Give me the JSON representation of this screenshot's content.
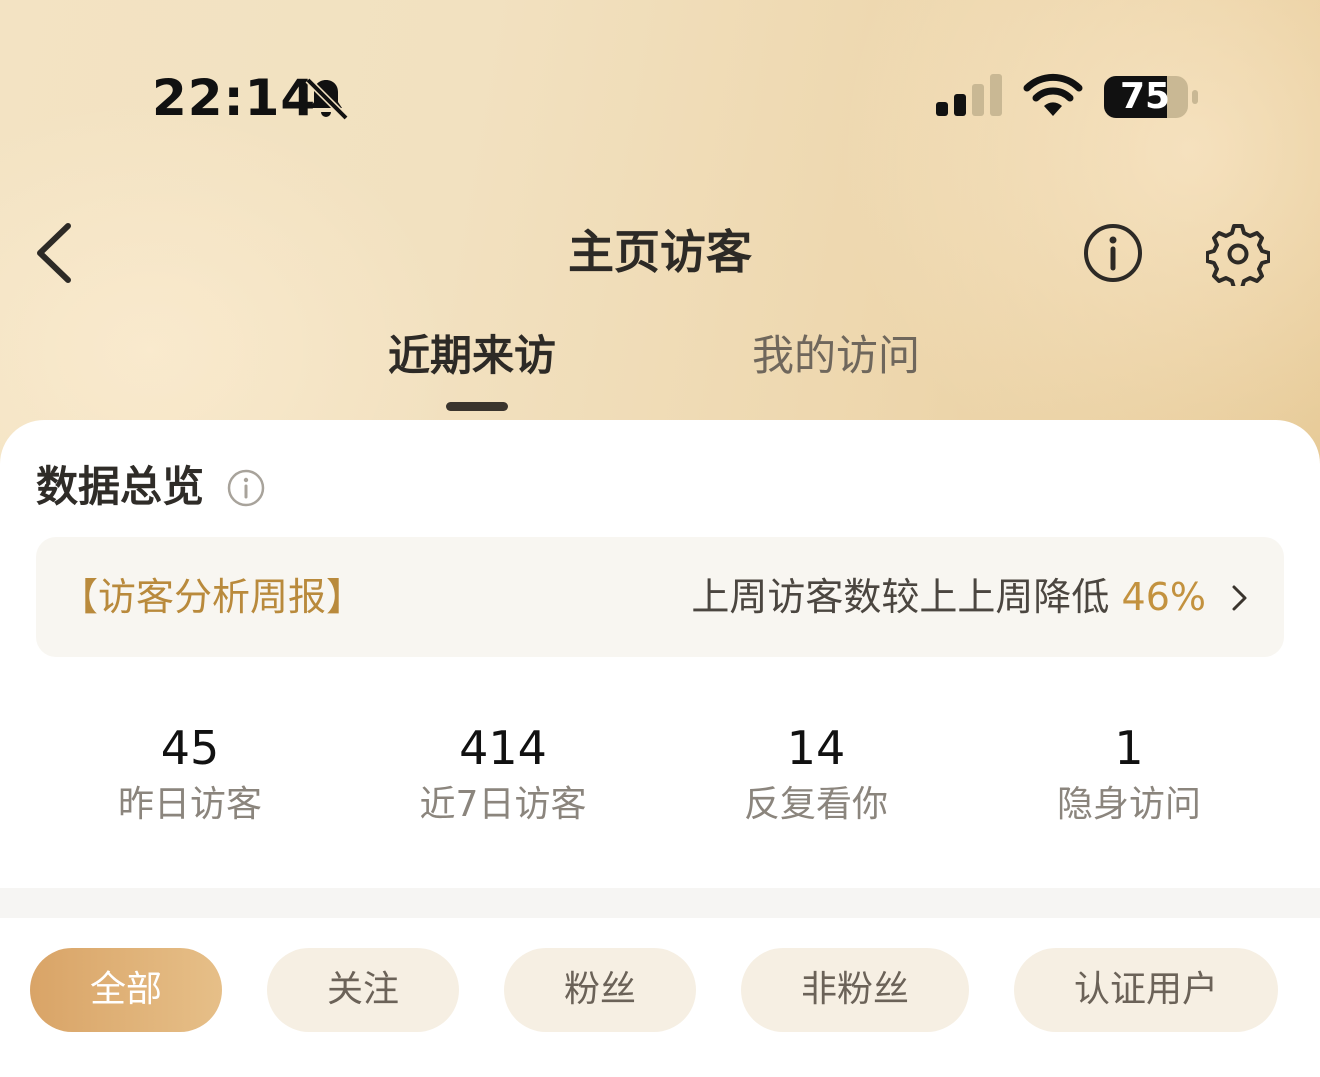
{
  "status_bar": {
    "time": "22:14",
    "battery_level": "75",
    "icons": [
      "bell-muted-icon",
      "signal-icon",
      "wifi-icon",
      "battery-icon"
    ]
  },
  "nav": {
    "title": "主页访客",
    "icons": [
      "back-arrow-icon",
      "info-icon",
      "gear-icon"
    ]
  },
  "tabs": [
    {
      "label": "近期来访",
      "active": true
    },
    {
      "label": "我的访问",
      "active": false
    }
  ],
  "overview": {
    "title": "数据总览",
    "weekly_report": {
      "title": "【访客分析周报】",
      "description": "上周访客数较上上周降低",
      "percent": "46%"
    },
    "stats": [
      {
        "value": "45",
        "label": "昨日访客"
      },
      {
        "value": "414",
        "label": "近7日访客"
      },
      {
        "value": "14",
        "label": "反复看你"
      },
      {
        "value": "1",
        "label": "隐身访问"
      }
    ]
  },
  "filters": [
    {
      "label": "全部",
      "active": true
    },
    {
      "label": "关注",
      "active": false
    },
    {
      "label": "粉丝",
      "active": false
    },
    {
      "label": "非粉丝",
      "active": false
    },
    {
      "label": "认证用户",
      "active": false
    }
  ],
  "colors": {
    "accent": "#c3923f",
    "chip_active": "#d9a467",
    "chip_bg": "#f6efe3",
    "header_bg": "#f0ddb8"
  }
}
